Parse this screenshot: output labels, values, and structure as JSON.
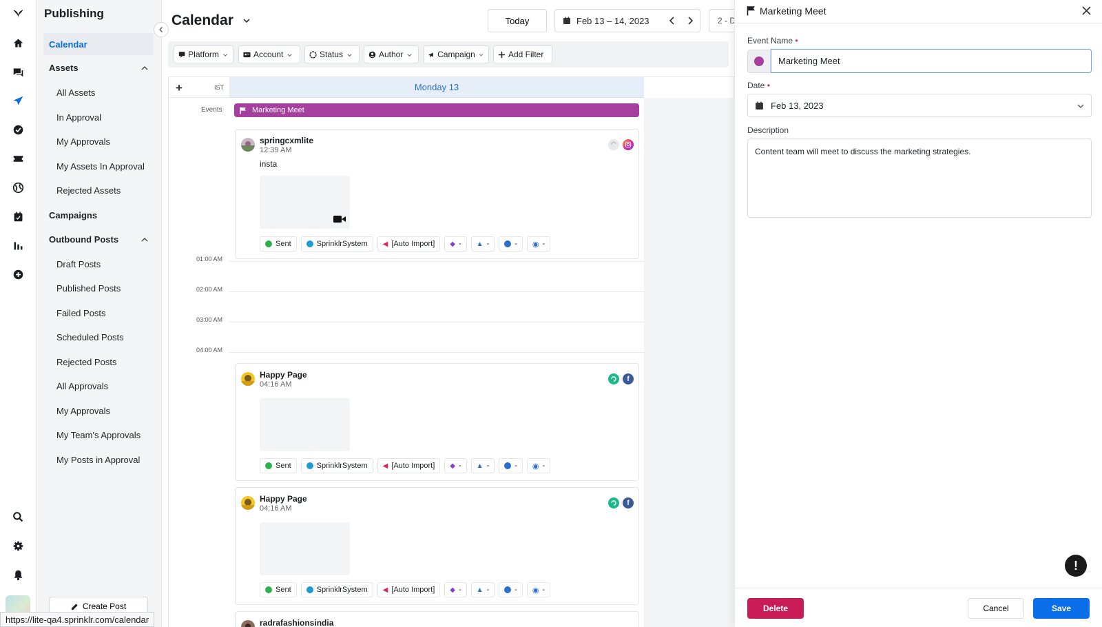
{
  "rail": {
    "icons": [
      "sprinklr-logo-icon",
      "home-icon",
      "inbox-icon",
      "publishing-icon",
      "approvals-icon",
      "ticket-icon",
      "globe-icon",
      "planner-icon",
      "reports-icon",
      "add-icon",
      "search-icon",
      "settings-icon",
      "notifications-icon"
    ]
  },
  "nav": {
    "title": "Publishing",
    "calendar": "Calendar",
    "assets_section": "Assets",
    "assets": [
      "All Assets",
      "In Approval",
      "My Approvals",
      "My Assets In Approval",
      "Rejected Assets"
    ],
    "campaigns": "Campaigns",
    "outbound_section": "Outbound Posts",
    "outbound": [
      "Draft Posts",
      "Published Posts",
      "Failed Posts",
      "Scheduled Posts",
      "Rejected Posts",
      "All Approvals",
      "My Approvals",
      "My Team's Approvals",
      "My Posts in Approval"
    ],
    "create_post": "Create Post"
  },
  "status_url": "https://lite-qa4.sprinklr.com/calendar",
  "header": {
    "title": "Calendar",
    "today": "Today",
    "date_range": "Feb 13 – 14, 2023",
    "view": "2 - D"
  },
  "filters": [
    "Platform",
    "Account",
    "Status",
    "Author",
    "Campaign"
  ],
  "add_filter": "Add Filter",
  "calendar": {
    "timezone": "IST",
    "day_header": "Monday 13",
    "events_label": "Events",
    "event_name": "Marketing Meet",
    "hours": [
      "01:00 AM",
      "02:00 AM",
      "03:00 AM",
      "04:00 AM"
    ]
  },
  "posts": [
    {
      "name": "springcxmlite",
      "time": "12:39 AM",
      "text": "insta",
      "status": "Sent",
      "user": "SprinklrSystem",
      "campaign": "[Auto Import]",
      "m1": "-",
      "m2": "-",
      "m3": "-",
      "m4": "-"
    },
    {
      "name": "Happy Page",
      "time": "04:16 AM",
      "text": "",
      "status": "Sent",
      "user": "SprinklrSystem",
      "campaign": "[Auto Import]",
      "m1": "-",
      "m2": "-",
      "m3": "-",
      "m4": "-"
    },
    {
      "name": "Happy Page",
      "time": "04:16 AM",
      "text": "",
      "status": "Sent",
      "user": "SprinklrSystem",
      "campaign": "[Auto Import]",
      "m1": "-",
      "m2": "-",
      "m3": "-",
      "m4": "-"
    },
    {
      "name": "radrafashionsindia"
    }
  ],
  "panel": {
    "title": "Marketing Meet",
    "event_name_label": "Event Name",
    "event_name_value": "Marketing Meet",
    "date_label": "Date",
    "date_value": "Feb 13, 2023",
    "description_label": "Description",
    "description_value": "Content team will meet to discuss the marketing strategies.",
    "required_mark": "•",
    "help": "!",
    "delete": "Delete",
    "cancel": "Cancel",
    "save": "Save"
  },
  "colors": {
    "accent": "#0a6fe8",
    "event": "#a6409f",
    "danger": "#c91c56",
    "link": "#0a6fd6"
  }
}
